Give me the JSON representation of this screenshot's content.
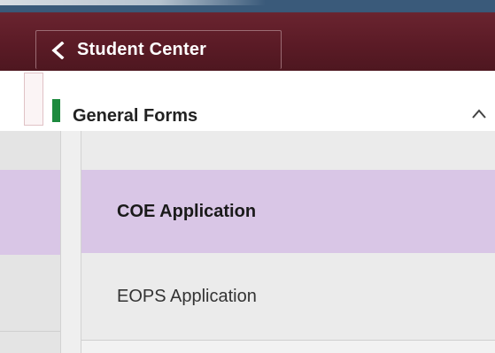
{
  "header": {
    "back_label": "Student Center",
    "back_icon": "chevron-left-icon",
    "brand_color": "#5b1b26"
  },
  "group": {
    "title": "General Forms",
    "toggle_icon": "chevron-up-icon",
    "marker_color": "#1d8a3e"
  },
  "menu": {
    "items": [
      {
        "label": "COE Application",
        "selected": true
      },
      {
        "label": "EOPS Application",
        "selected": false
      }
    ],
    "selected_color": "#d9c6e6",
    "item_bg": "#ebebeb"
  }
}
